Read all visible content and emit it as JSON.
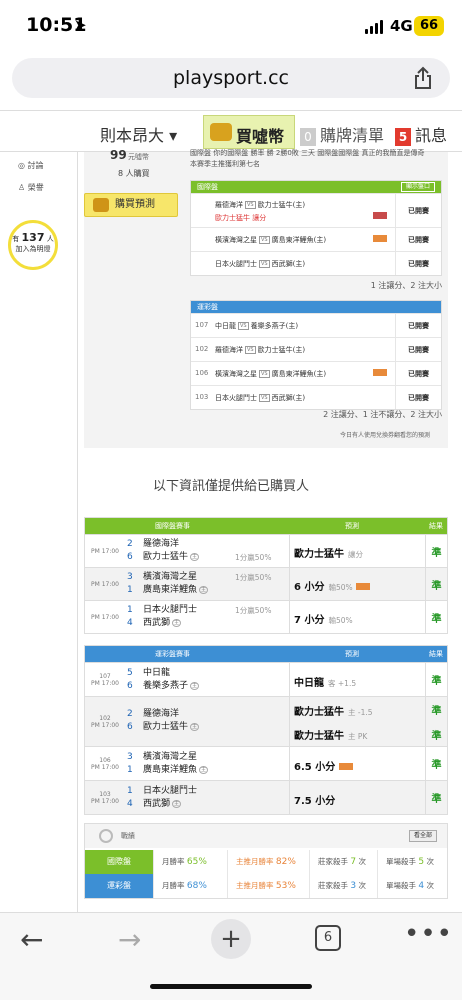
{
  "status_bar": {
    "time": "10:51",
    "network": "4G",
    "battery": "66"
  },
  "browser": {
    "url": "playsport.cc"
  },
  "nav": {
    "user": "則本昂大 ▾",
    "buy": "買噓幣",
    "list_count": "0",
    "list": "購牌清單",
    "msg_count": "5",
    "msg": "訊息"
  },
  "sidebar": {
    "items": [
      "討論",
      "榮譽"
    ],
    "bulb_prefix": "有",
    "bulb_count": "137",
    "bulb_suffix": "人",
    "bulb_line2": "加入為明燈"
  },
  "buy_panel": {
    "price": "99",
    "price_unit": "元噓幣",
    "buyers": "8 人購買",
    "predict_button": "購買預測",
    "desc_line1": "國際盤 你的國際盤 勝率 勝 2勝0敗 三天 國際盤國際盤 真正的我簡直是傳奇",
    "desc_line2": "本賽季主推獲利第七名"
  },
  "intl_table": {
    "title": "國際盤",
    "toggle": "顯示盤口",
    "rows": [
      {
        "home": "羅德海洋",
        "away": "歐力士猛牛(主)",
        "pick": "歐力士猛牛",
        "pick_note": "讓分",
        "status": "已開賽"
      },
      {
        "home": "橫濱海灣之星",
        "away": "廣島東洋鯉魚(主)",
        "status": "已開賽"
      },
      {
        "home": "日本火腿鬥士",
        "away": "西武獅(主)",
        "status": "已開賽"
      }
    ],
    "summary": "1 注讓分、2 注大小"
  },
  "lottery_table": {
    "title": "運彩盤",
    "rows": [
      {
        "no": "107",
        "home": "中日龍",
        "away": "養樂多燕子(主)",
        "status": "已開賽"
      },
      {
        "no": "102",
        "home": "羅德海洋",
        "away": "歐力士猛牛(主)",
        "status": "已開賽"
      },
      {
        "no": "106",
        "home": "橫濱海灣之星",
        "away": "廣島東洋鯉魚(主)",
        "status": "已開賽"
      },
      {
        "no": "103",
        "home": "日本火腿鬥士",
        "away": "西武獅(主)",
        "status": "已開賽"
      }
    ],
    "summary": "2 注讓分、1 注不讓分、2 注大小"
  },
  "usage_note": "今日有人使用兌換券翻看您的預測",
  "info_title": "以下資訊僅提供給已購買人",
  "intl_results": {
    "headers": [
      "國際盤賽事",
      "預測",
      "結果"
    ],
    "rows": [
      {
        "time": "PM 17:00",
        "s1": "2",
        "s2": "6",
        "t1": "羅德海洋",
        "t2": "歐力士猛牛",
        "odds": "1分贏50%",
        "pred": "歐力士猛牛",
        "pred_note": "讓分",
        "result": "準"
      },
      {
        "time": "PM 17:00",
        "s1": "3",
        "s2": "1",
        "t1": "橫濱海灣之星",
        "t2": "廣島東洋鯉魚",
        "odds": "1分贏50%",
        "pred": "6 小分",
        "pred_note": "輸50%",
        "result": "準"
      },
      {
        "time": "PM 17:00",
        "s1": "1",
        "s2": "4",
        "t1": "日本火腿鬥士",
        "t2": "西武獅",
        "odds": "1分贏50%",
        "pred": "7 小分",
        "pred_note": "輸50%",
        "result": "準"
      }
    ]
  },
  "lottery_results": {
    "headers": [
      "運彩盤賽事",
      "預測",
      "結果"
    ],
    "rows": [
      {
        "no": "107",
        "time": "PM 17:00",
        "s1": "5",
        "s2": "6",
        "t1": "中日龍",
        "t2": "養樂多燕子",
        "preds": [
          {
            "pick": "中日龍",
            "note": "客 +1.5"
          }
        ],
        "results": [
          "準"
        ]
      },
      {
        "no": "102",
        "time": "PM 17:00",
        "s1": "2",
        "s2": "6",
        "t1": "羅德海洋",
        "t2": "歐力士猛牛",
        "preds": [
          {
            "pick": "歐力士猛牛",
            "note": "主 -1.5"
          },
          {
            "pick": "歐力士猛牛",
            "note": "主 PK"
          }
        ],
        "results": [
          "準",
          "準"
        ]
      },
      {
        "no": "106",
        "time": "PM 17:00",
        "s1": "3",
        "s2": "1",
        "t1": "橫濱海灣之星",
        "t2": "廣島東洋鯉魚",
        "preds": [
          {
            "pick": "6.5 小分",
            "note": ""
          }
        ],
        "results": [
          "準"
        ]
      },
      {
        "no": "103",
        "time": "PM 17:00",
        "s1": "1",
        "s2": "4",
        "t1": "日本火腿鬥士",
        "t2": "西武獅",
        "preds": [
          {
            "pick": "7.5 小分",
            "note": ""
          }
        ],
        "results": [
          "準"
        ]
      }
    ]
  },
  "home_marker": "主",
  "stats": {
    "title": "戰績",
    "view_all": "看全部",
    "rows": [
      {
        "label": "國際盤",
        "win_label": "月勝率",
        "win": "65",
        "home_label": "主推月勝率",
        "home": "82",
        "killer_label": "莊家殺手",
        "killer": "7",
        "single_label": "單場殺手",
        "single": "5",
        "unit": "次"
      },
      {
        "label": "運彩盤",
        "win_label": "月勝率",
        "win": "68",
        "home_label": "主推月勝率",
        "home": "53",
        "killer_label": "莊家殺手",
        "killer": "3",
        "single_label": "單場殺手",
        "single": "4",
        "unit": "次"
      }
    ]
  },
  "toolbar": {
    "tabs_count": "6"
  },
  "colors": {
    "green": "#7bbf2a",
    "blue": "#3d8fd4",
    "win": "#2a9a2a"
  }
}
